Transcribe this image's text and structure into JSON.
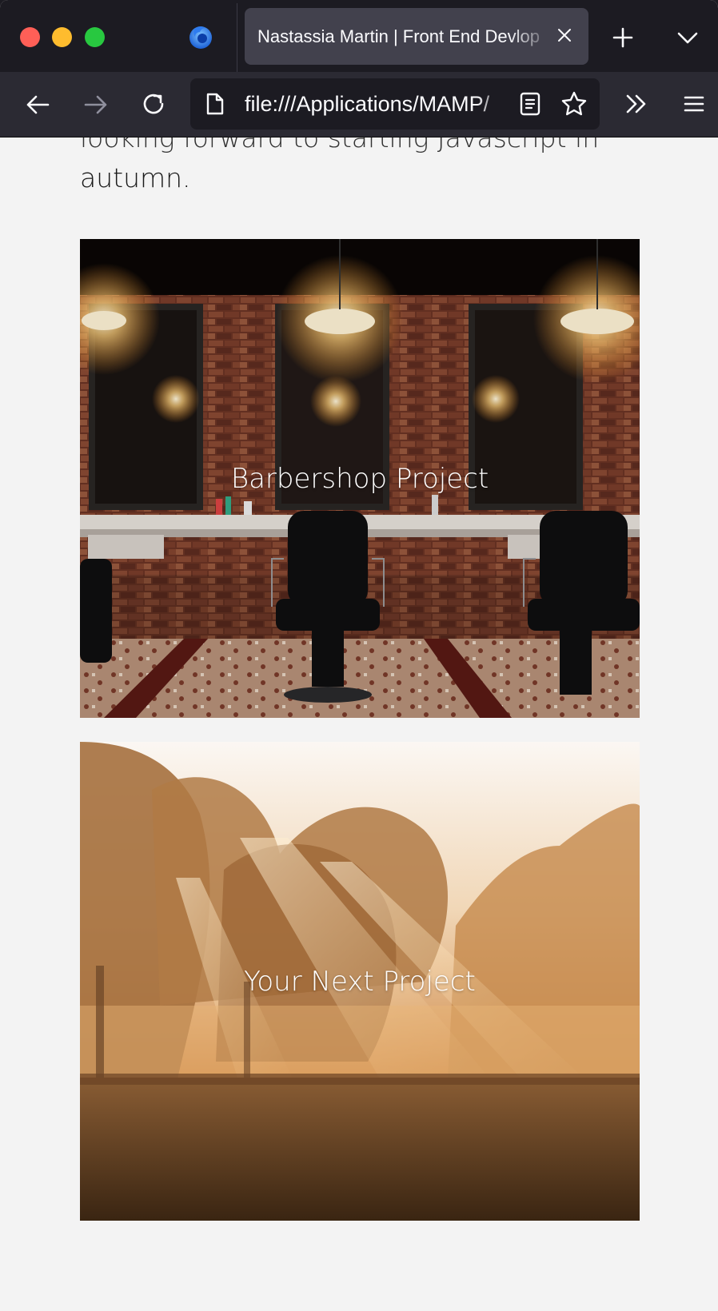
{
  "browser": {
    "tab": {
      "title": "Nastassia Martin | Front End Devlop"
    },
    "url": "file:///Applications/MAMP/"
  },
  "page": {
    "intro_partial_line": "looking forward to starting Javascript in the",
    "intro_last_line": "autumn.",
    "projects": [
      {
        "label": "Barbershop Project"
      },
      {
        "label": "Your Next Project"
      }
    ]
  },
  "colors": {
    "toolbar_bg": "#2b2a33",
    "tabstrip_bg": "#1c1b22",
    "page_bg": "#f3f3f3"
  }
}
